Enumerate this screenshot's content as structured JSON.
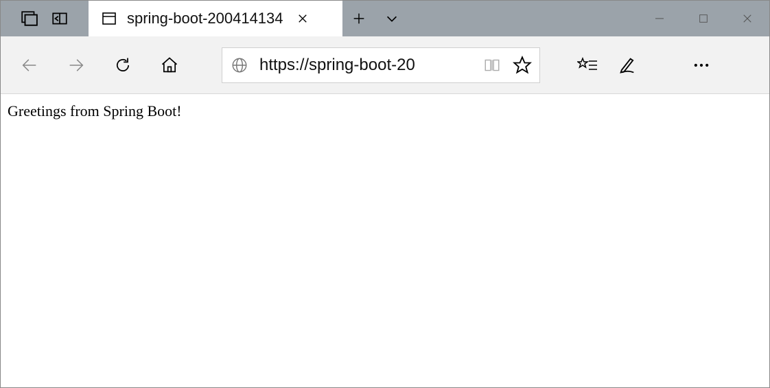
{
  "titleBar": {
    "panelIcon": "panel-icon",
    "setAsideIcon": "set-aside-icon"
  },
  "tab": {
    "title": "spring-boot-200414134"
  },
  "windowControls": {
    "minimize": "minimize",
    "maximize": "maximize",
    "close": "close"
  },
  "addressBar": {
    "url": "https://spring-boot-20"
  },
  "content": {
    "bodyText": "Greetings from Spring Boot!"
  }
}
